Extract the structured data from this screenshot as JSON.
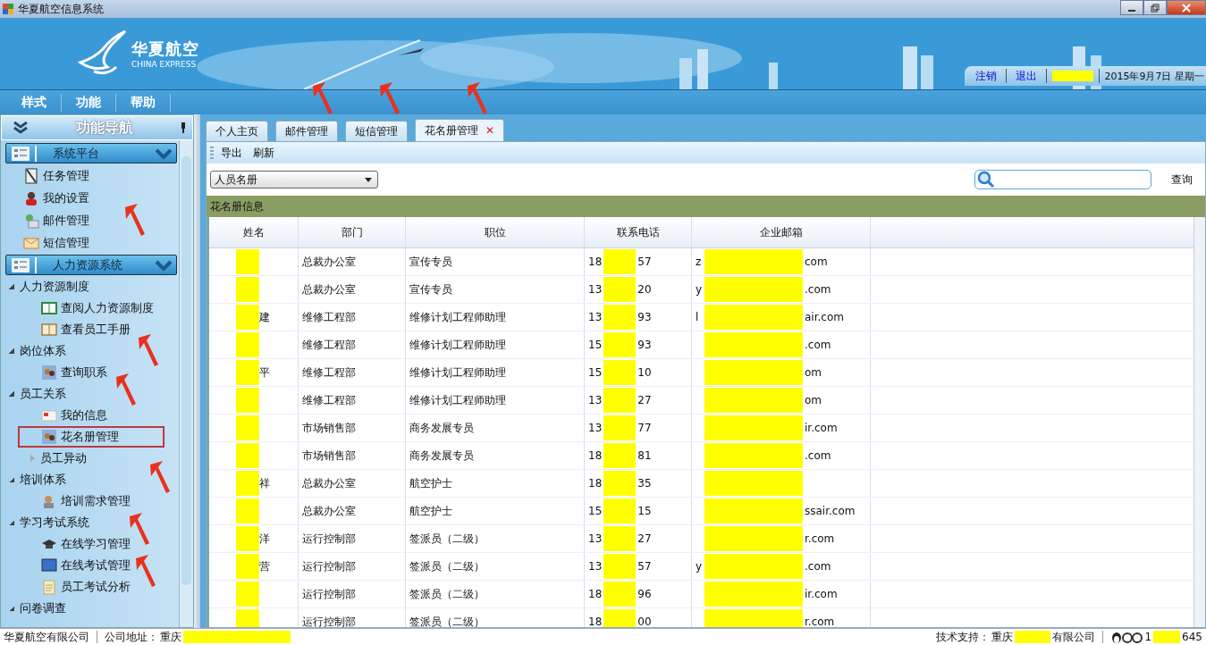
{
  "window": {
    "title": "华夏航空信息系统"
  },
  "header": {
    "logo_cn": "华夏航空",
    "logo_en": "CHINA EXPRESS",
    "links": [
      "注销",
      "退出"
    ],
    "date": "2015年9月7日 星期一"
  },
  "menu": [
    "样式",
    "功能",
    "帮助"
  ],
  "sidebar": {
    "title": "功能导航",
    "panels": [
      {
        "title": "系统平台",
        "expanded": true,
        "items": [
          {
            "label": "任务管理",
            "selected": false
          },
          {
            "label": "我的设置",
            "selected": false
          },
          {
            "label": "邮件管理",
            "selected": false
          },
          {
            "label": "短信管理",
            "selected": false
          }
        ]
      },
      {
        "title": "人力资源系统",
        "expanded": true,
        "tree": [
          {
            "label": "人力资源制度",
            "expanded": true,
            "children": [
              {
                "label": "查阅人力资源制度",
                "selected": false,
                "highlighted": false
              },
              {
                "label": "查看员工手册",
                "selected": false,
                "highlighted": false
              }
            ]
          },
          {
            "label": "岗位体系",
            "expanded": true,
            "children": [
              {
                "label": "查询职系",
                "selected": false,
                "highlighted": false
              }
            ]
          },
          {
            "label": "员工关系",
            "expanded": true,
            "children": [
              {
                "label": "我的信息",
                "selected": false,
                "highlighted": false
              },
              {
                "label": "花名册管理",
                "selected": true,
                "highlighted": true
              },
              {
                "label": "员工异动",
                "kind": "folder",
                "expanded": false
              }
            ]
          },
          {
            "label": "培训体系",
            "expanded": true,
            "children": [
              {
                "label": "培训需求管理",
                "selected": false,
                "highlighted": false
              }
            ]
          },
          {
            "label": "学习考试系统",
            "expanded": true,
            "children": [
              {
                "label": "在线学习管理",
                "selected": false,
                "highlighted": false
              },
              {
                "label": "在线考试管理",
                "selected": false,
                "highlighted": false
              },
              {
                "label": "员工考试分析",
                "selected": false,
                "highlighted": false
              }
            ]
          },
          {
            "label": "问卷调查",
            "expanded": true
          }
        ]
      }
    ]
  },
  "tabs": [
    {
      "label": "个人主页",
      "selected": false,
      "closable": false
    },
    {
      "label": "邮件管理",
      "selected": false,
      "closable": false
    },
    {
      "label": "短信管理",
      "selected": false,
      "closable": false
    },
    {
      "label": "花名册管理",
      "selected": true,
      "closable": true
    }
  ],
  "close_glyph": "✕",
  "toolbar": [
    "导出",
    "刷新"
  ],
  "filter": {
    "value": "人员名册",
    "search_button": "查询"
  },
  "section_title": "花名册信息",
  "table": {
    "columns": [
      "姓名",
      "部门",
      "职位",
      "联系电话",
      "企业邮箱"
    ],
    "rows": [
      {
        "name_end": "",
        "dept": "总裁办公室",
        "title": "宣传专员",
        "phone_start": "18",
        "phone_end": "57",
        "email_start": "z",
        "email_end": "com"
      },
      {
        "name_end": "",
        "dept": "总裁办公室",
        "title": "宣传专员",
        "phone_start": "13",
        "phone_end": "20",
        "email_start": "y",
        "email_end": ".com"
      },
      {
        "name_end": "建",
        "dept": "维修工程部",
        "title": "维修计划工程师助理",
        "phone_start": "13",
        "phone_end": "93",
        "email_start": "l",
        "email_end": "air.com"
      },
      {
        "name_end": "",
        "dept": "维修工程部",
        "title": "维修计划工程师助理",
        "phone_start": "15",
        "phone_end": "93",
        "email_start": "",
        "email_end": ".com"
      },
      {
        "name_end": "平",
        "dept": "维修工程部",
        "title": "维修计划工程师助理",
        "phone_start": "15",
        "phone_end": "10",
        "email_start": "",
        "email_end": "om"
      },
      {
        "name_end": "",
        "dept": "维修工程部",
        "title": "维修计划工程师助理",
        "phone_start": "13",
        "phone_end": "27",
        "email_start": "",
        "email_end": "om"
      },
      {
        "name_end": "",
        "dept": "市场销售部",
        "title": "商务发展专员",
        "phone_start": "13",
        "phone_end": "77",
        "email_start": "",
        "email_end": "ir.com"
      },
      {
        "name_end": "",
        "dept": "市场销售部",
        "title": "商务发展专员",
        "phone_start": "18",
        "phone_end": "81",
        "email_start": "",
        "email_end": ".com"
      },
      {
        "name_end": "祥",
        "dept": "总裁办公室",
        "title": "航空护士",
        "phone_start": "18",
        "phone_end": "35",
        "email_start": "",
        "email_end": ""
      },
      {
        "name_end": "",
        "dept": "总裁办公室",
        "title": "航空护士",
        "phone_start": "15",
        "phone_end": "15",
        "email_start": "",
        "email_end": "ssair.com"
      },
      {
        "name_end": "洋",
        "dept": "运行控制部",
        "title": "签派员（二级）",
        "phone_start": "13",
        "phone_end": "27",
        "email_start": "",
        "email_end": "r.com"
      },
      {
        "name_end": "营",
        "dept": "运行控制部",
        "title": "签派员（二级）",
        "phone_start": "13",
        "phone_end": "57",
        "email_start": "y",
        "email_end": ".com"
      },
      {
        "name_end": "",
        "dept": "运行控制部",
        "title": "签派员（二级）",
        "phone_start": "18",
        "phone_end": "96",
        "email_start": "",
        "email_end": "ir.com"
      },
      {
        "name_end": "",
        "dept": "运行控制部",
        "title": "签派员（二级）",
        "phone_start": "18",
        "phone_end": "00",
        "email_start": "",
        "email_end": "r.com"
      }
    ]
  },
  "status_bar": {
    "company": "华夏航空有限公司",
    "address_label": "公司地址：",
    "address_start": "重庆",
    "support_label": "技术支持：",
    "support_start": "重庆",
    "support_end": "有限公司",
    "qq_start": "1",
    "qq_end": "645"
  }
}
